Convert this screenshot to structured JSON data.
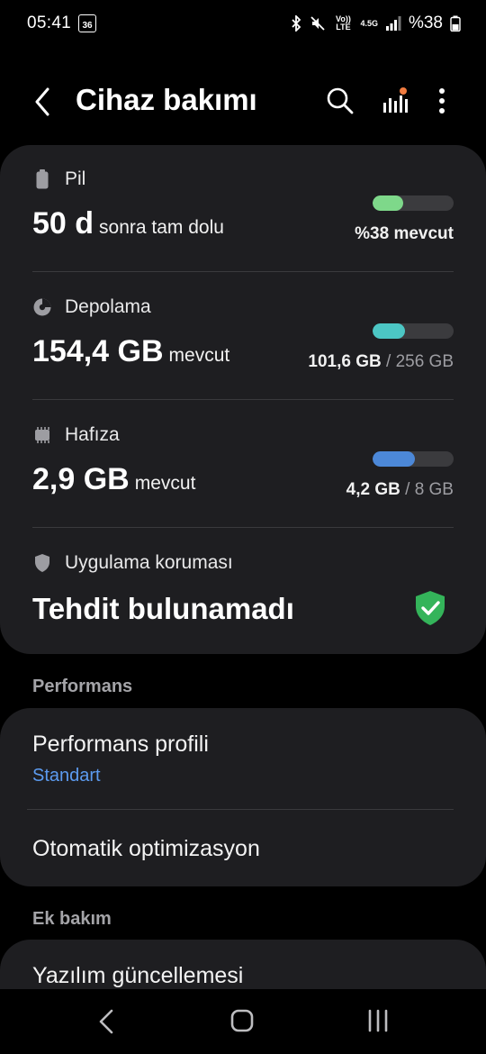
{
  "status_bar": {
    "time": "05:41",
    "notif_badge": "36",
    "volte": "Vo)) LTE",
    "net": "4.5G",
    "battery_text": "%38"
  },
  "app_bar": {
    "title": "Cihaz bakımı"
  },
  "battery": {
    "label": "Pil",
    "value": "50 d",
    "value_suffix": "sonra tam dolu",
    "right_text": "%38 mevcut",
    "fill_percent": 38,
    "color": "#7ed88a"
  },
  "storage": {
    "label": "Depolama",
    "value": "154,4 GB",
    "value_suffix": "mevcut",
    "used": "101,6 GB",
    "separator": " / ",
    "total": "256 GB",
    "fill_percent": 40,
    "color": "#4cc6c4"
  },
  "memory": {
    "label": "Hafıza",
    "value": "2,9 GB",
    "value_suffix": "mevcut",
    "used": "4,2 GB",
    "separator": " / ",
    "total": "8 GB",
    "fill_percent": 52,
    "color": "#4c88d8"
  },
  "app_protection": {
    "label": "Uygulama koruması",
    "status": "Tehdit bulunamadı",
    "shield_color": "#34b45a"
  },
  "performance_section": {
    "header": "Performans",
    "profile_title": "Performans profili",
    "profile_value": "Standart",
    "auto_opt": "Otomatik optimizasyon"
  },
  "extra_section": {
    "header": "Ek bakım",
    "software_update": "Yazılım güncellemesi"
  }
}
